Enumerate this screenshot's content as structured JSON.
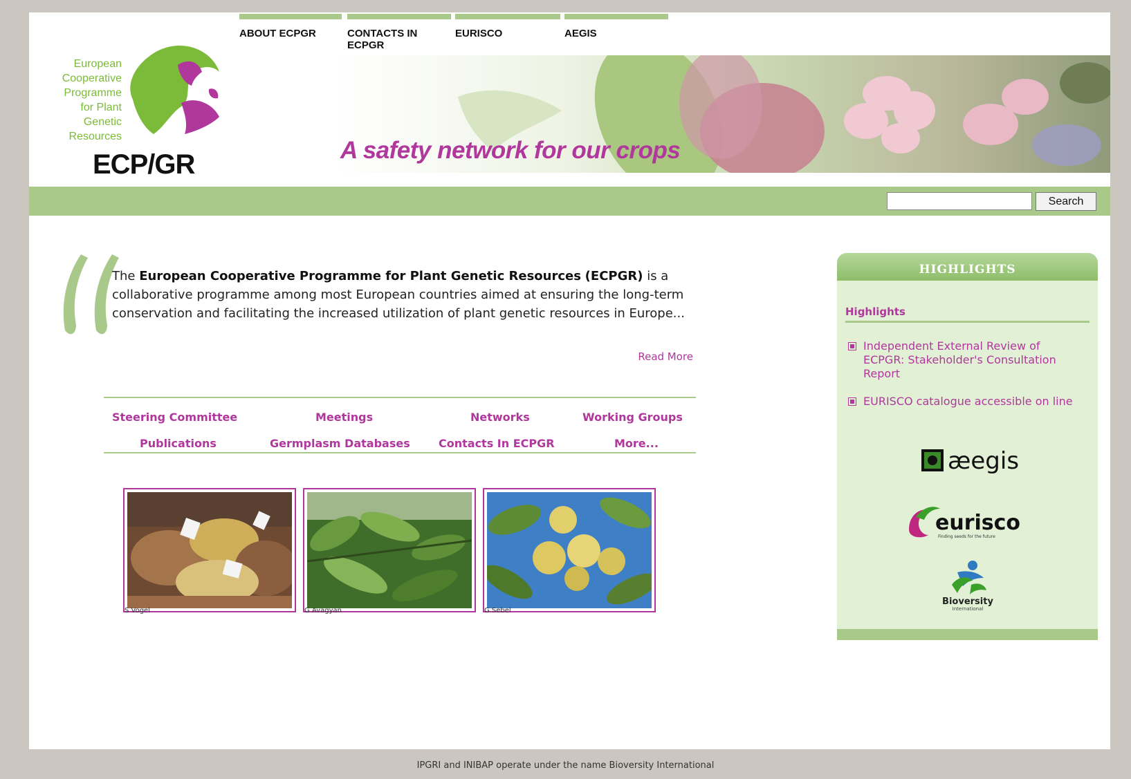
{
  "nav": {
    "items": [
      {
        "label": "ABOUT ECPGR"
      },
      {
        "label": "CONTACTS IN ECPGR"
      },
      {
        "label": "EURISCO"
      },
      {
        "label": "AEGIS"
      }
    ]
  },
  "logo": {
    "lines": [
      "European",
      "Cooperative",
      "Programme",
      "for Plant",
      "Genetic",
      "Resources"
    ],
    "abbr": "ECP/GR"
  },
  "banner": {
    "tagline": "A safety network for our crops"
  },
  "search": {
    "value": "",
    "button_label": "Search"
  },
  "intro": {
    "prefix": "The ",
    "bold_name": "European Cooperative Programme for Plant Genetic Resources",
    "bold_abbr": "(ECPGR)",
    "body": " is a collaborative programme among most European countries aimed at ensuring the long-term conservation and facilitating the increased utilization of plant genetic resources in Europe...",
    "read_more": "Read More"
  },
  "quick_links": [
    {
      "label": "Steering Committee"
    },
    {
      "label": "Meetings"
    },
    {
      "label": "Networks"
    },
    {
      "label": "Working Groups"
    },
    {
      "label": "Publications"
    },
    {
      "label": "Germplasm Databases"
    },
    {
      "label": "Contacts In ECPGR"
    },
    {
      "label": "More..."
    }
  ],
  "photos": [
    {
      "caption": "S Vogel"
    },
    {
      "caption": "G Avagyan"
    },
    {
      "caption": "G Sebel"
    }
  ],
  "sidebar": {
    "header": "HIGHLIGHTS",
    "subheader": "Highlights",
    "items": [
      {
        "label": "Independent External Review of ECPGR: Stakeholder's Consultation Report"
      },
      {
        "label": "EURISCO catalogue accessible on line"
      }
    ],
    "partners": {
      "aegis": "æegis",
      "eurisco": "eurisco",
      "eurisco_tag": "Finding seeds for the future",
      "bioversity": "Bioversity",
      "bioversity_tag": "International"
    }
  },
  "footer": {
    "text": "IPGRI and INIBAP operate under the name Bioversity International"
  },
  "colors": {
    "accent_magenta": "#b0379c",
    "accent_green": "#a8c98a",
    "sidebar_bg": "#e2f1d6"
  }
}
